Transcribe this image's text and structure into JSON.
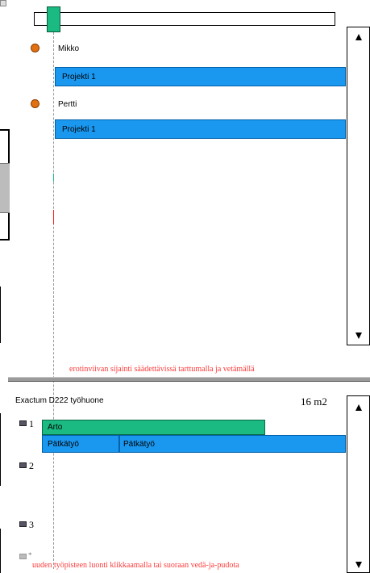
{
  "top_panel": {
    "persons": [
      {
        "name": "Mikko",
        "project": "Projekti 1"
      },
      {
        "name": "Pertti",
        "project": "Projekti 1"
      }
    ],
    "hint": "erotinviivan sijainti säädettävissä tarttumalla ja vetämällä"
  },
  "room": {
    "title": "Exactum D222 työhuone",
    "area": "16 m2",
    "workstations": [
      {
        "label": "1",
        "occupant": "Arto",
        "tasks": [
          "Pätkätyö",
          "Pätkätyö"
        ]
      },
      {
        "label": "2"
      },
      {
        "label": "3"
      }
    ],
    "new_label": "*",
    "hint": "uuden työpisteen luonti klikkaamalla tai suoraan vedä-ja-pudota"
  },
  "colors": {
    "project_bar": "#1a98f0",
    "occupant_bar": "#1aba82",
    "hint_text": "#ff3a3a",
    "splitter": "#9a9a9a"
  },
  "icons": {
    "person": "person-icon",
    "workstation": "computer-icon",
    "scroll_up": "arrow-up-icon",
    "scroll_down": "arrow-down-icon"
  }
}
